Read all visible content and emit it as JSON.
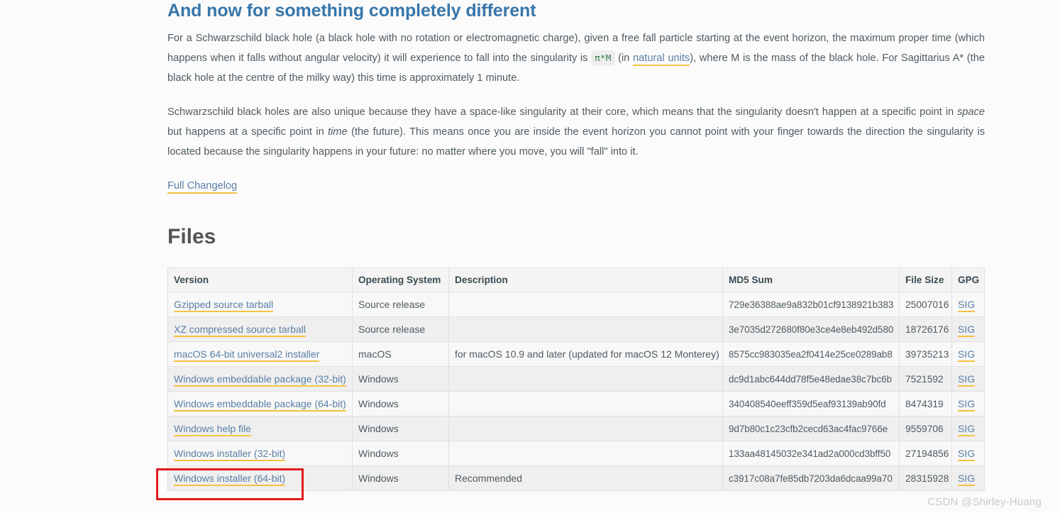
{
  "article": {
    "heading": "And now for something completely different",
    "para1": {
      "before_code": "For a Schwarzschild black hole (a black hole with no rotation or electromagnetic charge), given a free fall particle starting at the event horizon, the maximum proper time (which happens when it falls without angular velocity) it will experience to fall into the singularity is ",
      "code": "π*M",
      "after_code_a": " (in ",
      "link_text": "natural units",
      "after_link": "), where M is the mass of the black hole. For Sagittarius A* (the black hole at the centre of the milky way) this time is approximately 1 minute."
    },
    "para2": {
      "part1": "Schwarzschild black holes are also unique because they have a space-like singularity at their core, which means that the singularity doesn't happen at a specific point in ",
      "italic1": "space",
      "part2": " but happens at a specific point in ",
      "italic2": "time",
      "part3": " (the future). This means once you are inside the event horizon you cannot point with your finger towards the direction the singularity is located because the singularity happens in your future: no matter where you move, you will \"fall\" into it."
    },
    "changelog_link": "Full Changelog"
  },
  "files": {
    "heading": "Files",
    "columns": [
      "Version",
      "Operating System",
      "Description",
      "MD5 Sum",
      "File Size",
      "GPG"
    ],
    "rows": [
      {
        "version": "Gzipped source tarball",
        "os": "Source release",
        "description": "",
        "md5": "729e36388ae9a832b01cf9138921b383",
        "size": "25007016",
        "gpg": "SIG"
      },
      {
        "version": "XZ compressed source tarball",
        "os": "Source release",
        "description": "",
        "md5": "3e7035d272680f80e3ce4e8eb492d580",
        "size": "18726176",
        "gpg": "SIG"
      },
      {
        "version": "macOS 64-bit universal2 installer",
        "os": "macOS",
        "description": "for macOS 10.9 and later (updated for macOS 12 Monterey)",
        "md5": "8575cc983035ea2f0414e25ce0289ab8",
        "size": "39735213",
        "gpg": "SIG"
      },
      {
        "version": "Windows embeddable package (32-bit)",
        "os": "Windows",
        "description": "",
        "md5": "dc9d1abc644dd78f5e48edae38c7bc6b",
        "size": "7521592",
        "gpg": "SIG"
      },
      {
        "version": "Windows embeddable package (64-bit)",
        "os": "Windows",
        "description": "",
        "md5": "340408540eeff359d5eaf93139ab90fd",
        "size": "8474319",
        "gpg": "SIG"
      },
      {
        "version": "Windows help file",
        "os": "Windows",
        "description": "",
        "md5": "9d7b80c1c23cfb2cecd63ac4fac9766e",
        "size": "9559706",
        "gpg": "SIG"
      },
      {
        "version": "Windows installer (32-bit)",
        "os": "Windows",
        "description": "",
        "md5": "133aa48145032e341ad2a000cd3bff50",
        "size": "27194856",
        "gpg": "SIG"
      },
      {
        "version": "Windows installer (64-bit)",
        "os": "Windows",
        "description": "Recommended",
        "md5": "c3917c08a7fe85db7203da6dcaa99a70",
        "size": "28315928",
        "gpg": "SIG"
      }
    ]
  },
  "annotation": {
    "highlighted_row_version": "Windows installer (64-bit)",
    "box_color": "#e21b1b"
  },
  "watermark": "CSDN @Shirley-Huang",
  "theme": {
    "heading_blue": "#3776ab",
    "link_blue": "#5a7fa6",
    "link_underline": "#f5c242",
    "code_green": "#337a4d",
    "body_text": "#4f5b62",
    "page_bg": "#fbfbfb"
  }
}
